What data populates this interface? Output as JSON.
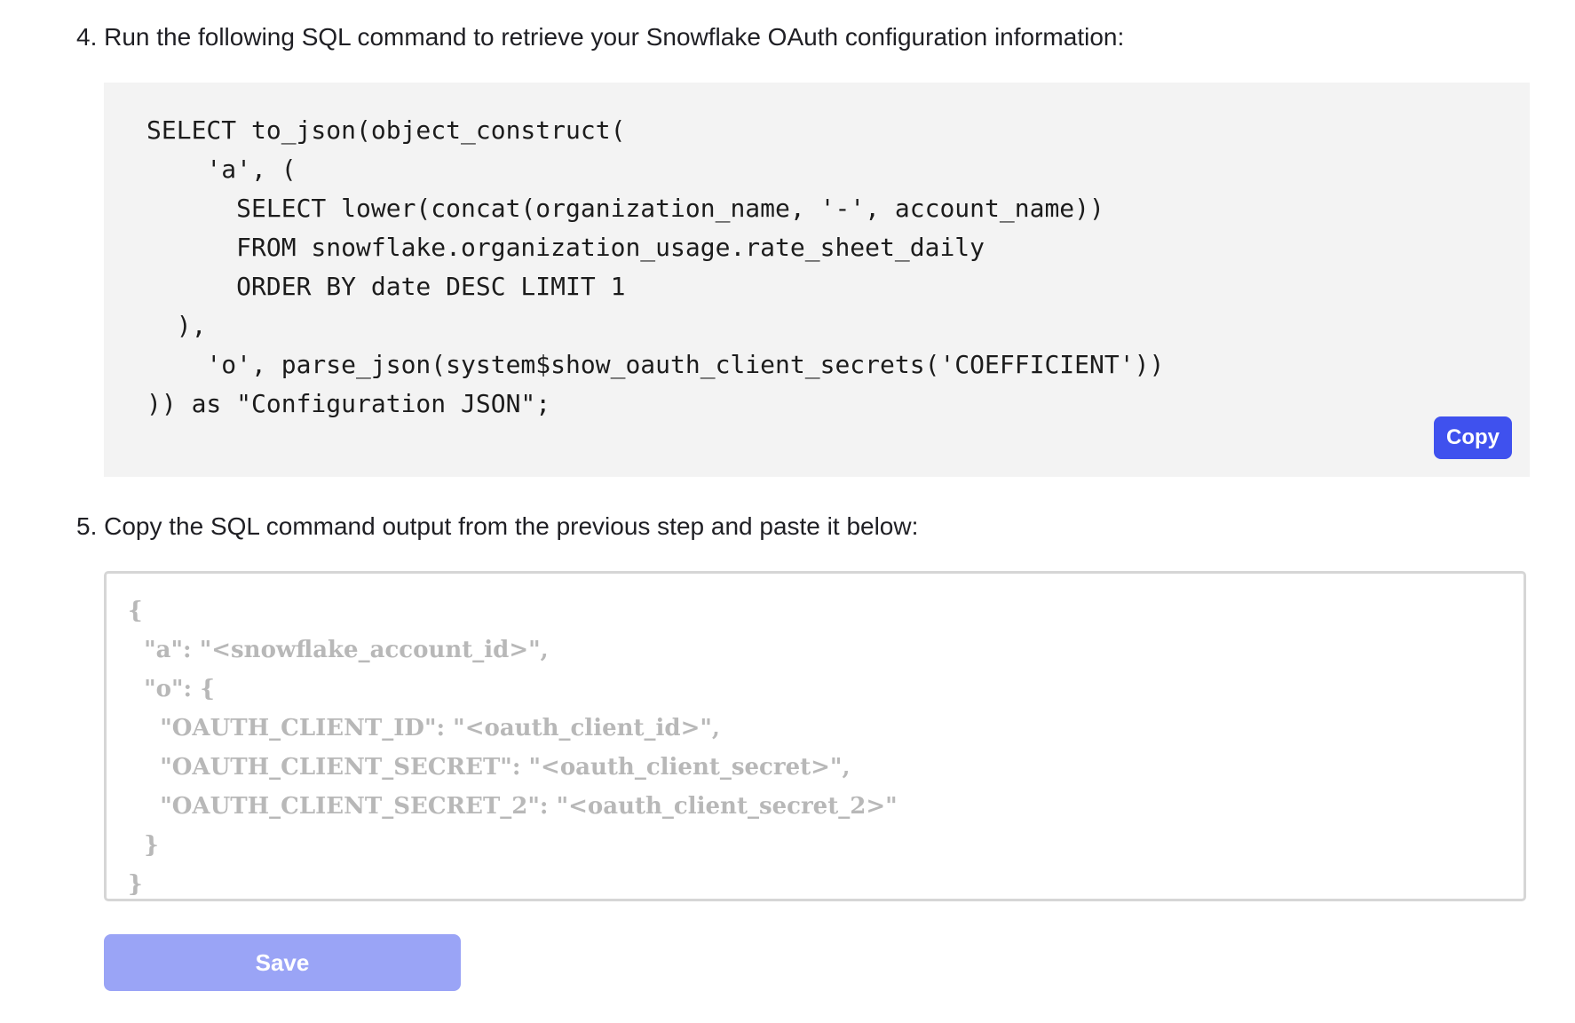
{
  "steps": {
    "step4_text": "4. Run the following SQL command to retrieve your Snowflake OAuth configuration information:",
    "step5_text": "5. Copy the SQL command output from the previous step and paste it below:"
  },
  "code_block": {
    "sql": "SELECT to_json(object_construct(\n    'a', (\n      SELECT lower(concat(organization_name, '-', account_name))\n      FROM snowflake.organization_usage.rate_sheet_daily\n      ORDER BY date DESC LIMIT 1\n  ),\n    'o', parse_json(system$show_oauth_client_secrets('COEFFICIENT'))\n)) as \"Configuration JSON\";",
    "copy_label": "Copy"
  },
  "json_input": {
    "value": "",
    "placeholder": "{\n  \"a\": \"<snowflake_account_id>\",\n  \"o\": {\n    \"OAUTH_CLIENT_ID\": \"<oauth_client_id>\",\n    \"OAUTH_CLIENT_SECRET\": \"<oauth_client_secret>\",\n    \"OAUTH_CLIENT_SECRET_2\": \"<oauth_client_secret_2>\"\n  }\n}"
  },
  "save_button": {
    "label": "Save",
    "state": "disabled"
  },
  "colors": {
    "copy_button_bg": "#3f51ee",
    "save_button_bg_disabled": "#9aa4f6",
    "code_block_bg": "#f3f3f3",
    "input_border": "#d6d6d6",
    "placeholder_text": "#b8b8b8"
  }
}
